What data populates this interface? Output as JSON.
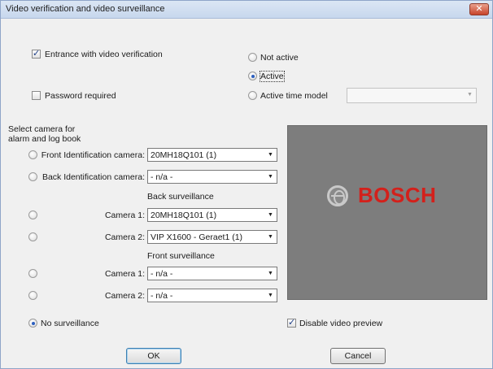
{
  "window": {
    "title": "Video verification and video surveillance",
    "close_glyph": "✕"
  },
  "verification": {
    "entrance_label": "Entrance with video verification",
    "entrance_checked": true,
    "password_label": "Password required",
    "password_checked": false
  },
  "mode": {
    "not_active": "Not active",
    "active": "Active",
    "active_time_model": "Active time model",
    "selected": "active",
    "time_model_value": ""
  },
  "camera_select": {
    "heading_line1": "Select camera for",
    "heading_line2": "alarm and log book",
    "front_id_label": "Front Identification camera:",
    "front_id_value": "20MH18Q101 (1)",
    "back_id_label": "Back Identification camera:",
    "back_id_value": "- n/a -",
    "back_surveillance_heading": "Back surveillance",
    "back_cam1_label": "Camera 1:",
    "back_cam1_value": "20MH18Q101 (1)",
    "back_cam2_label": "Camera 2:",
    "back_cam2_value": "VIP X1600 - Geraet1 (1)",
    "front_surveillance_heading": "Front surveillance",
    "front_cam1_label": "Camera 1:",
    "front_cam1_value": "- n/a -",
    "front_cam2_label": "Camera 2:",
    "front_cam2_value": "- n/a -",
    "no_surveillance_label": "No surveillance",
    "selected": "no_surveillance"
  },
  "preview": {
    "logo_text": "BOSCH",
    "logo_color": "#d3201b"
  },
  "disable_preview": {
    "label": "Disable video preview",
    "checked": true
  },
  "buttons": {
    "ok": "OK",
    "cancel": "Cancel"
  }
}
